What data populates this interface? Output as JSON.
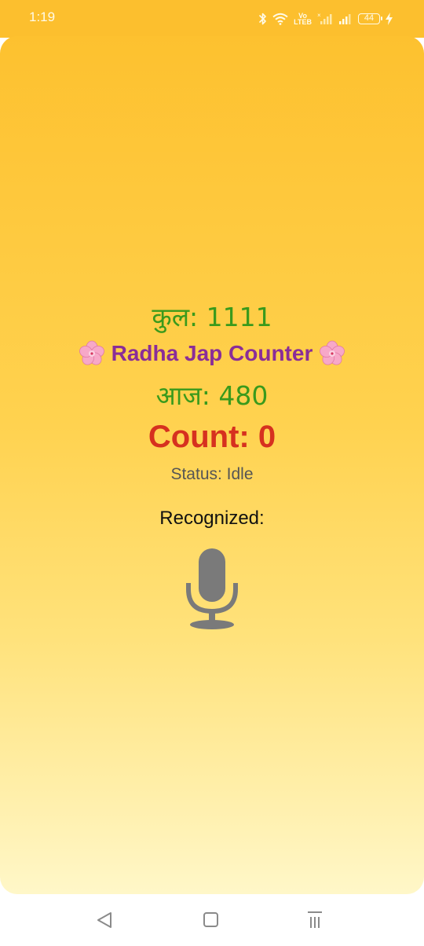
{
  "status_bar": {
    "time": "1:19",
    "volte_top": "Vo",
    "volte_bottom": "LTEB",
    "battery": "44"
  },
  "app": {
    "total_label": "कुल: 1111",
    "title": "Radha Jap Counter",
    "title_icon": "cherry-blossom-icon",
    "today_label": "आज: 480",
    "count_label": "Count: 0",
    "status_label": "Status: Idle",
    "recognized_label": "Recognized:",
    "mic_icon": "microphone-icon"
  },
  "colors": {
    "status_bar_bg": "#fcbf2e",
    "total_green": "#3a9a1c",
    "title_purple": "#8a2d98",
    "count_red": "#d6311f",
    "status_gray": "#555555",
    "mic_gray": "#7a7a7a"
  },
  "nav_bar": {
    "back_icon": "back-triangle-icon",
    "home_icon": "home-square-icon",
    "recents_icon": "recents-lines-icon"
  }
}
